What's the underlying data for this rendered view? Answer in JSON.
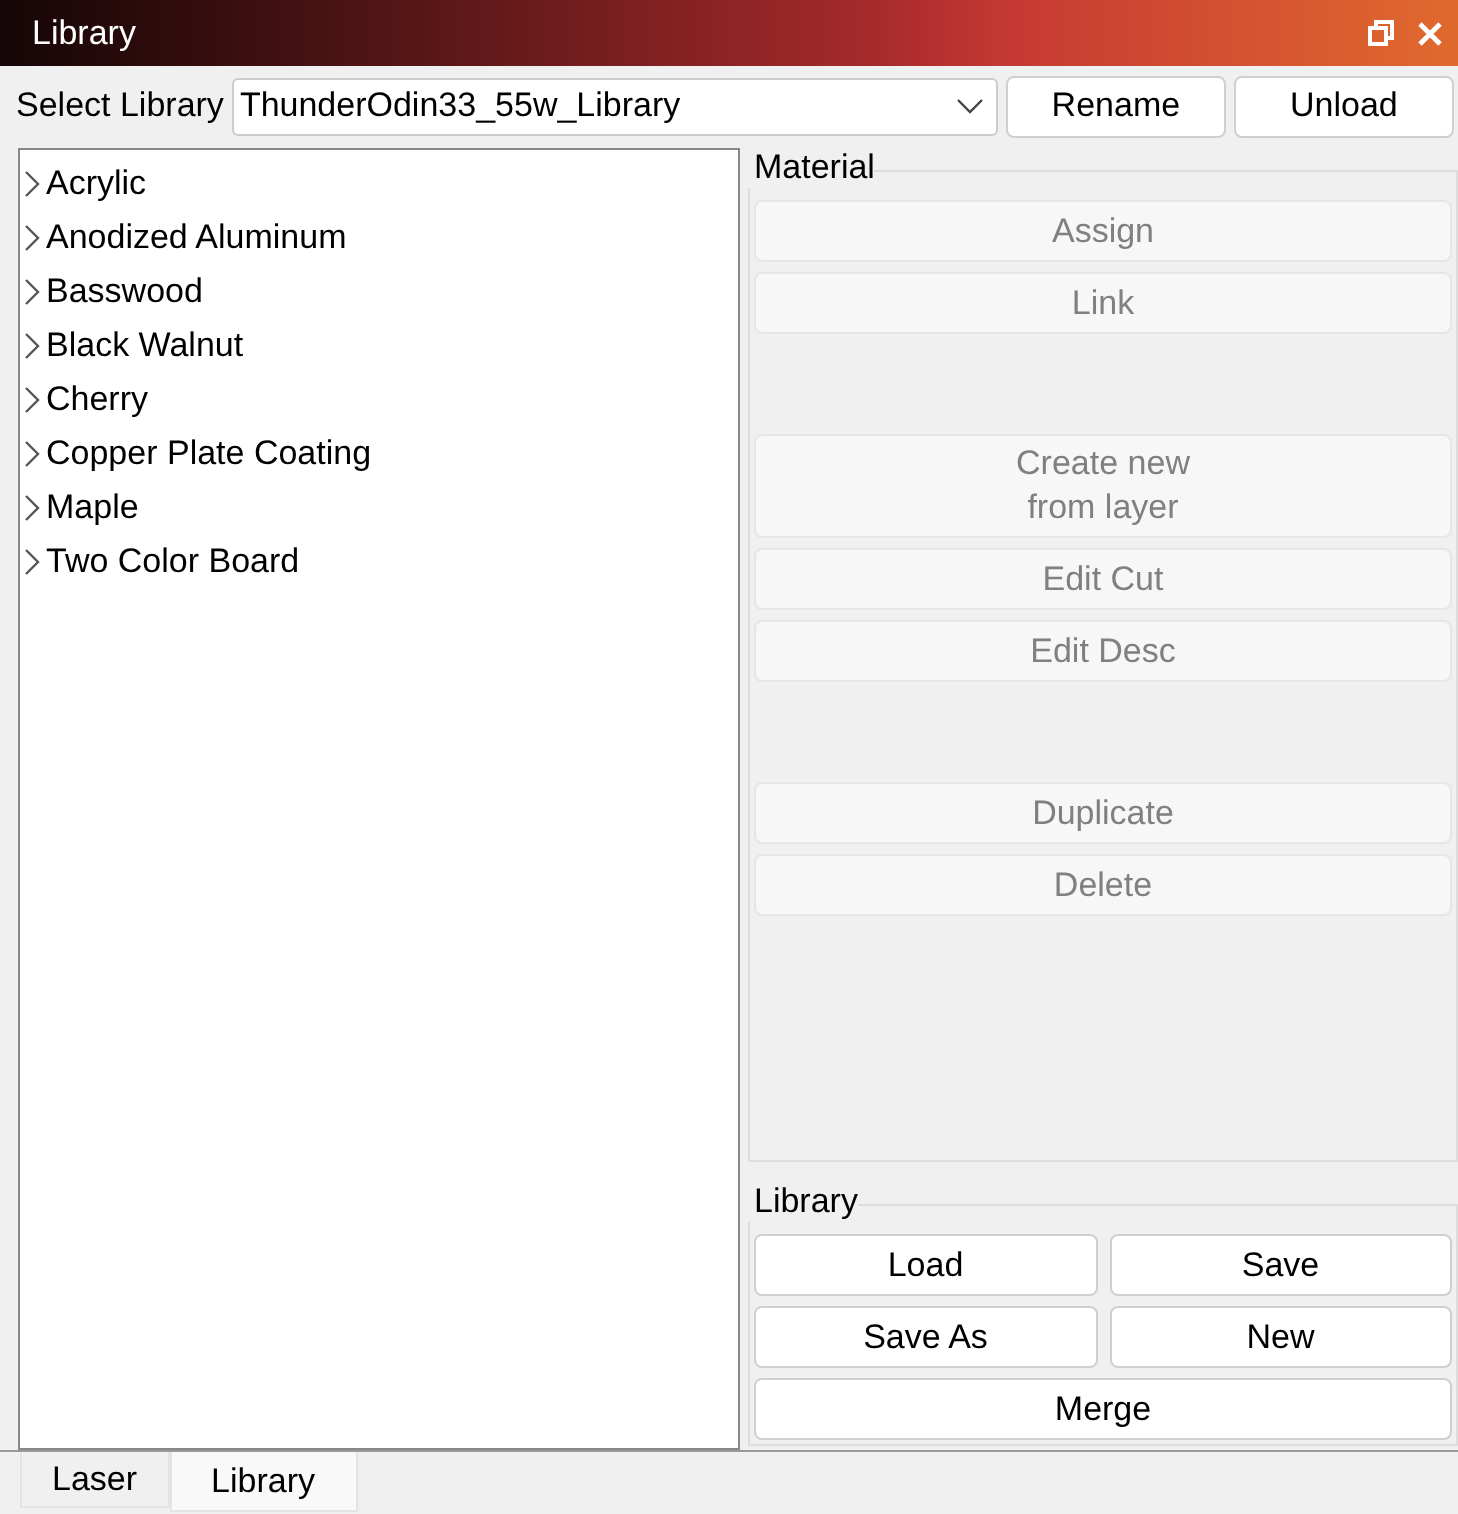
{
  "window": {
    "title": "Library"
  },
  "library_select": {
    "label": "Select Library",
    "value": "ThunderOdin33_55w_Library"
  },
  "top_buttons": [
    "Rename",
    "Unload"
  ],
  "tree": {
    "items": [
      {
        "label": "Acrylic",
        "expanded": false
      },
      {
        "label": "Anodized Aluminum",
        "expanded": false
      },
      {
        "label": "Basswood",
        "expanded": false
      },
      {
        "label": "Black Walnut",
        "expanded": false
      },
      {
        "label": "Cherry",
        "expanded": false
      },
      {
        "label": "Copper Plate Coating",
        "expanded": false
      },
      {
        "label": "Maple",
        "expanded": false
      },
      {
        "label": "Two Color Board",
        "expanded": false
      }
    ]
  },
  "material_group": {
    "title": "Material",
    "items": [
      {
        "kind": "button",
        "label": "Assign",
        "disabled": true
      },
      {
        "kind": "button",
        "label": "Link",
        "disabled": true
      },
      {
        "kind": "spacer"
      },
      {
        "kind": "button",
        "label": "Create new\nfrom layer",
        "disabled": true
      },
      {
        "kind": "button",
        "label": "Edit Cut",
        "disabled": true
      },
      {
        "kind": "button",
        "label": "Edit Desc",
        "disabled": true
      },
      {
        "kind": "spacer"
      },
      {
        "kind": "button",
        "label": "Duplicate",
        "disabled": true
      },
      {
        "kind": "button",
        "label": "Delete",
        "disabled": true
      }
    ]
  },
  "library_group": {
    "title": "Library",
    "buttons": [
      "Load",
      "Save",
      "Save As",
      "New",
      "Merge"
    ]
  },
  "tabs": [
    {
      "label": "Laser",
      "selected": false
    },
    {
      "label": "Library",
      "selected": true
    }
  ]
}
